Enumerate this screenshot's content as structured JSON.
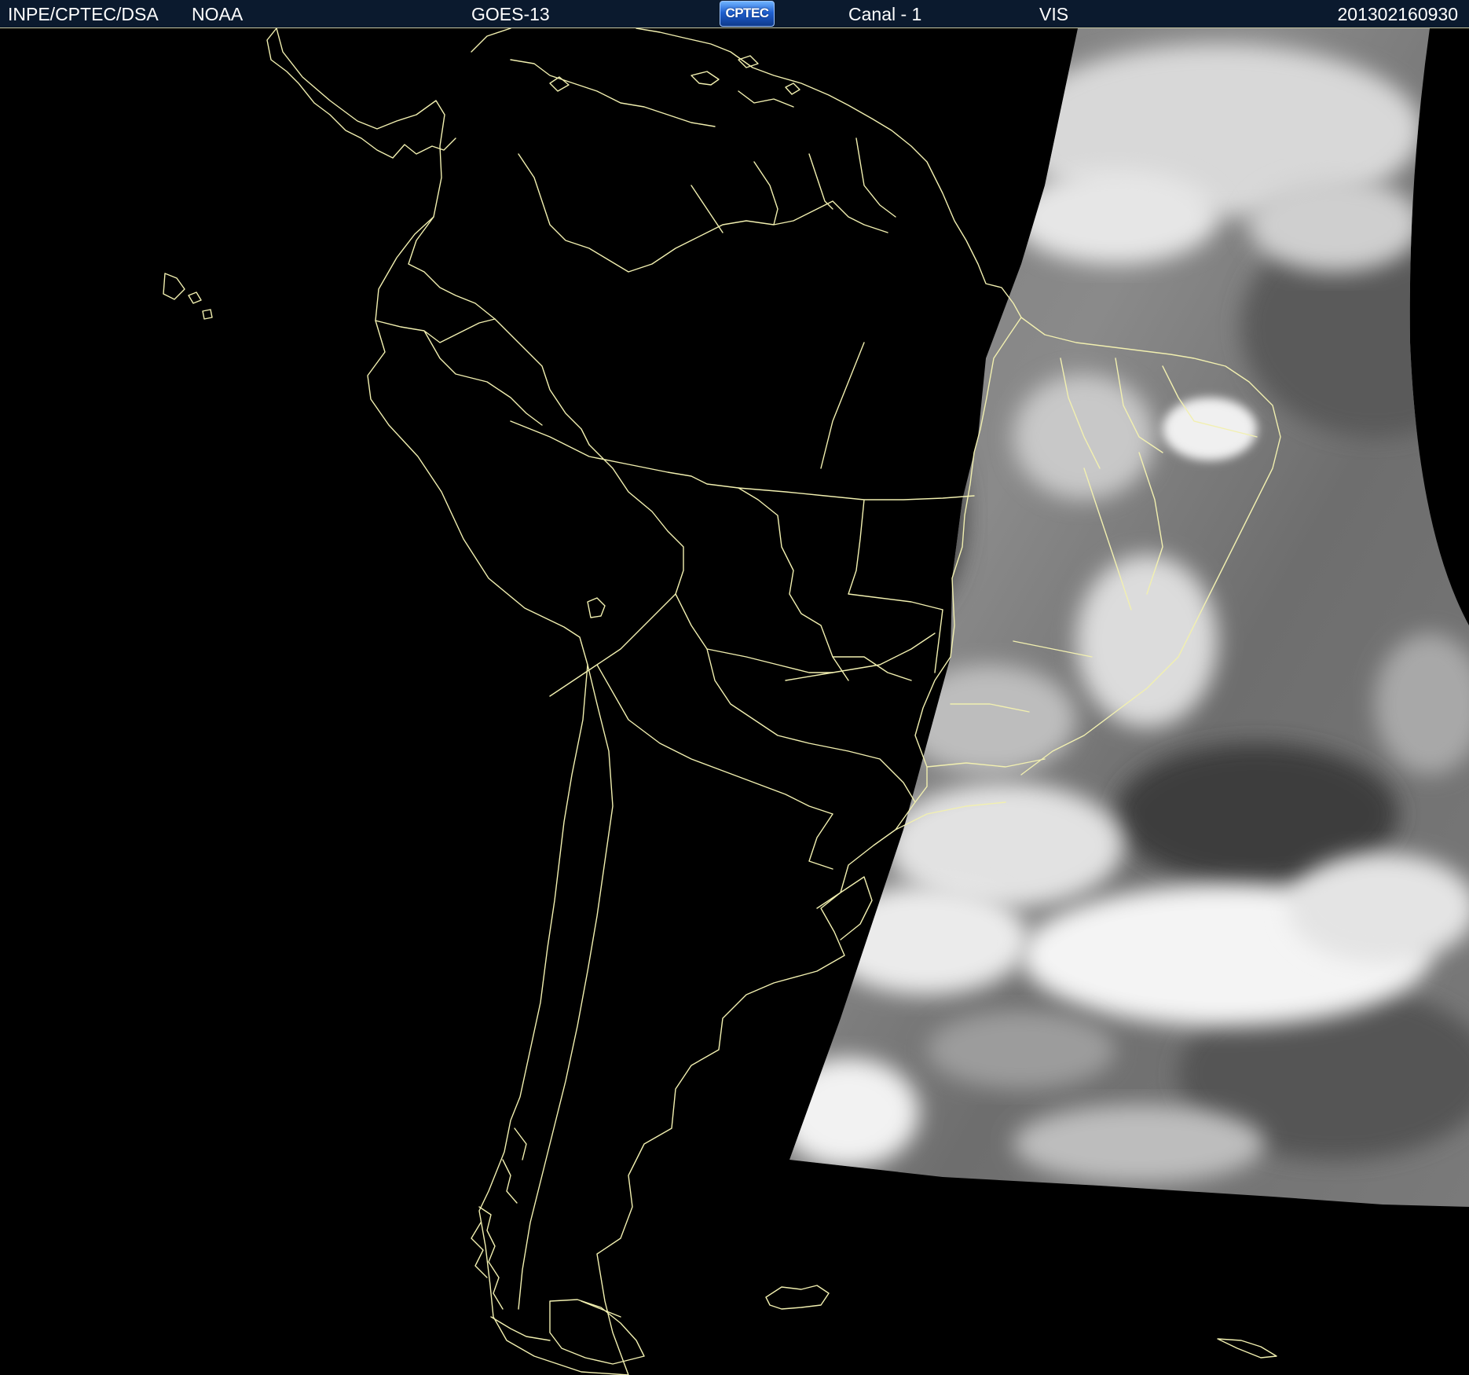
{
  "header": {
    "agency": "INPE/CPTEC/DSA",
    "source": "NOAA",
    "satellite": "GOES-13",
    "logo_text": "CPTEC",
    "channel": "Canal - 1",
    "band": "VIS",
    "timestamp": "201302160930"
  },
  "colors": {
    "background": "#000000",
    "header_background": "#0b1a2e",
    "header_text": "#ffffff",
    "coastline": "#f2f0b0"
  },
  "map": {
    "region": "South America",
    "imagery": "visible satellite scan, eastern portion only"
  }
}
